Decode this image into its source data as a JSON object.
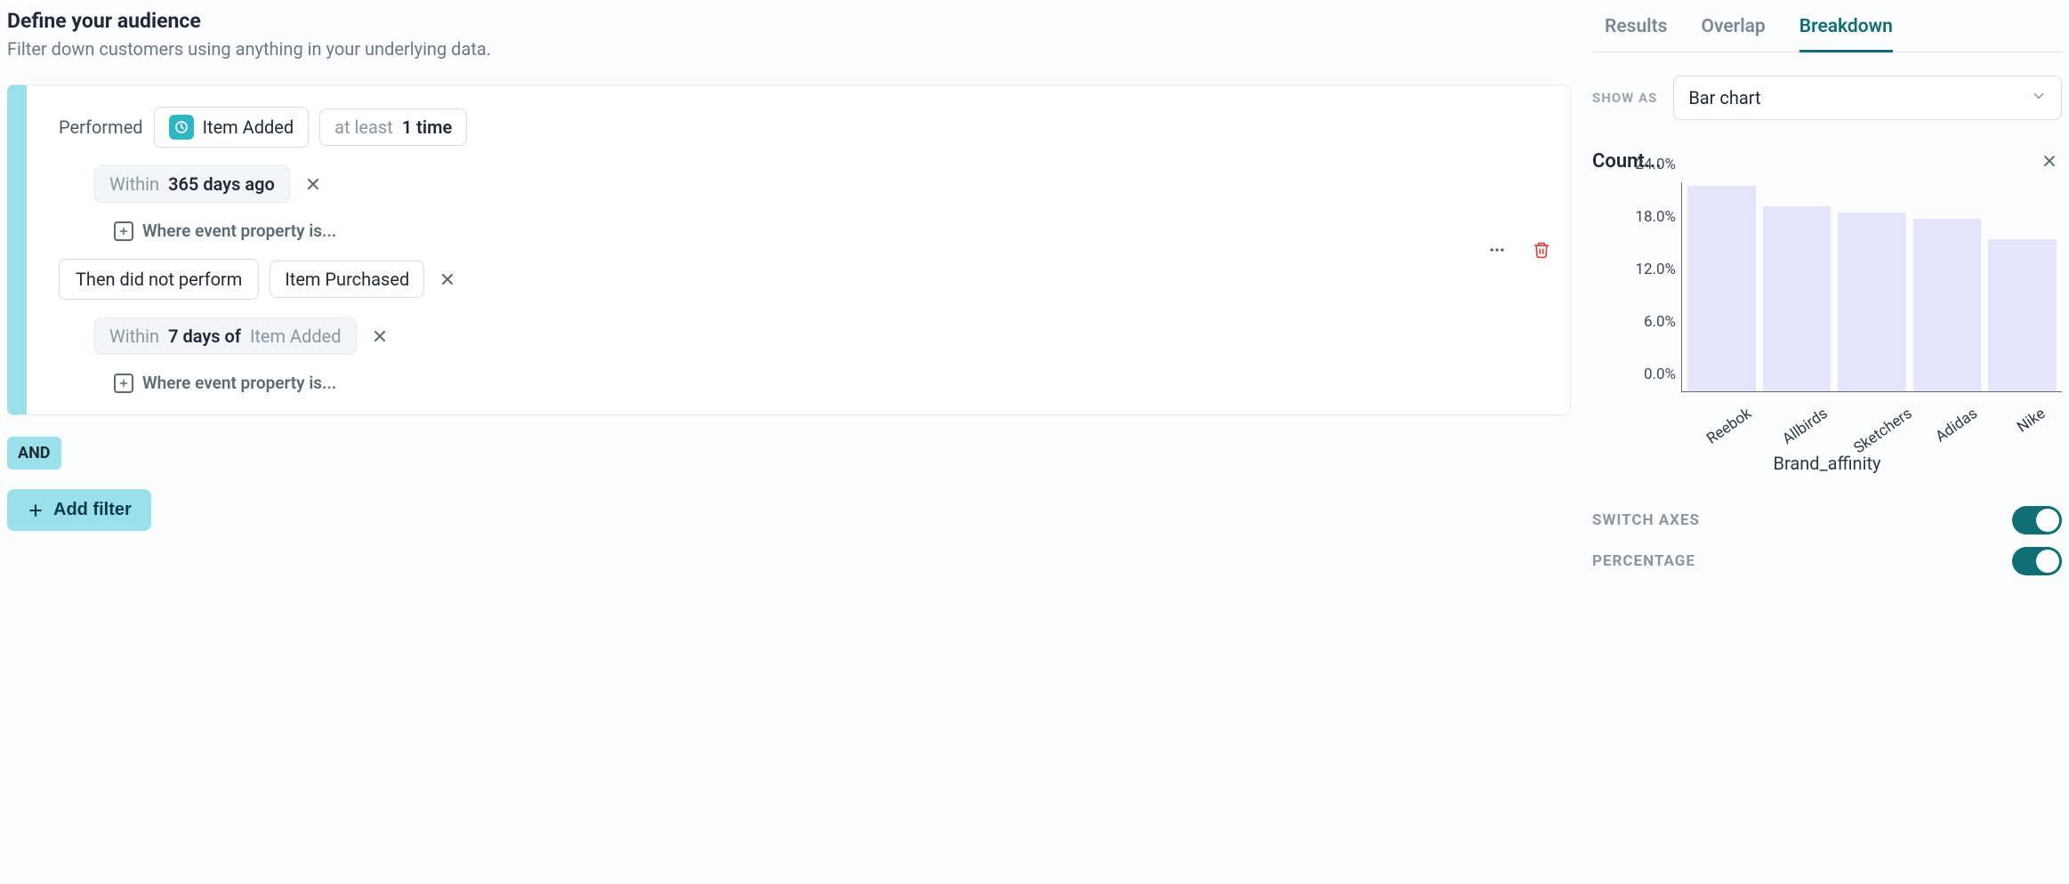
{
  "header": {
    "title": "Define your audience",
    "subtitle": "Filter down customers using anything in your underlying data."
  },
  "filter": {
    "performed_label": "Performed",
    "event1": "Item Added",
    "frequency_prefix": "at least",
    "frequency_value": "1 time",
    "time_prefix": "Within",
    "time_value": "365 days ago",
    "where_prop_label": "Where event property is...",
    "then_label": "Then did not perform",
    "event2": "Item Purchased",
    "funnel_prefix": "Within",
    "funnel_value": "7 days of",
    "funnel_ref": "Item Added",
    "and_label": "AND",
    "add_filter_label": "Add filter"
  },
  "tabs": {
    "results": "Results",
    "overlap": "Overlap",
    "breakdown": "Breakdown"
  },
  "side": {
    "show_as_label": "SHOW AS",
    "show_as_value": "Bar chart",
    "chart_title": "Count...",
    "x_axis_title": "Brand_affinity",
    "switch_axes_label": "SWITCH AXES",
    "percentage_label": "PERCENTAGE"
  },
  "chart_data": {
    "type": "bar",
    "title": "Count...",
    "xlabel": "Brand_affinity",
    "ylabel": "",
    "ylim": [
      0.0,
      24.0
    ],
    "y_tick_labels": [
      "0.0%",
      "6.0%",
      "12.0%",
      "18.0%",
      "24.0%"
    ],
    "categories": [
      "Reebok",
      "Allbirds",
      "Sketchers",
      "Adidas",
      "Nike"
    ],
    "values": [
      23.6,
      21.2,
      20.5,
      19.8,
      17.5
    ]
  }
}
